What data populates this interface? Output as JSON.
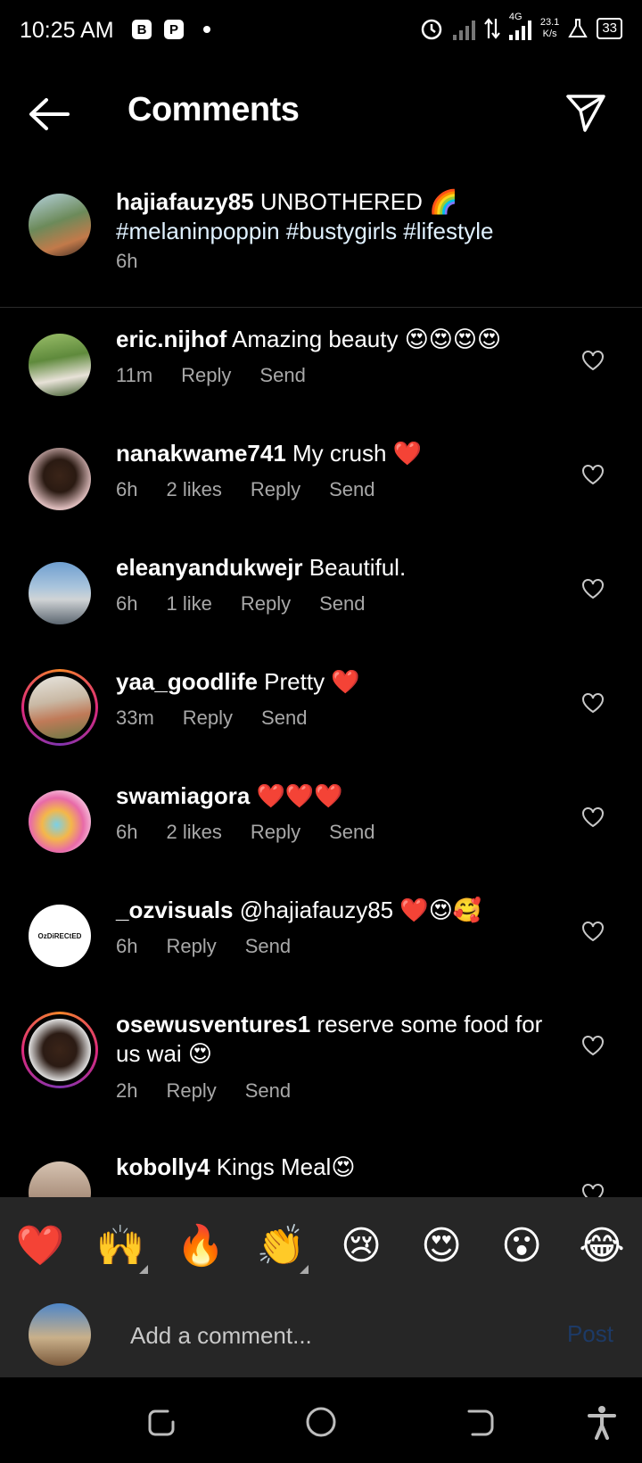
{
  "status_bar": {
    "time": "10:25 AM",
    "network": "4G",
    "speed_value": "23.1",
    "speed_unit": "K/s",
    "battery": "33"
  },
  "header": {
    "title": "Comments",
    "back_icon": "arrow-left-icon",
    "share_icon": "paper-plane-icon"
  },
  "caption": {
    "username": "hajiafauzy85",
    "text": " UNBOTHERED 🌈",
    "hashtags": "#melaninpoppin #bustygirls #lifestyle",
    "time": "6h"
  },
  "comments": [
    {
      "username": "eric.nijhof",
      "text": " Amazing beauty 😍😍😍😍",
      "time": "11m",
      "likes": "",
      "reply": "Reply",
      "send": "Send"
    },
    {
      "username": "nanakwame741",
      "text": " My crush ❤️",
      "time": "6h",
      "likes": "2 likes",
      "reply": "Reply",
      "send": "Send"
    },
    {
      "username": "eleanyandukwejr",
      "text": " Beautiful.",
      "time": "6h",
      "likes": "1 like",
      "reply": "Reply",
      "send": "Send"
    },
    {
      "username": "yaa_goodlife",
      "text": " Pretty ❤️",
      "time": "33m",
      "likes": "",
      "reply": "Reply",
      "send": "Send"
    },
    {
      "username": "swamiagora",
      "text": " ❤️❤️❤️",
      "time": "6h",
      "likes": "2 likes",
      "reply": "Reply",
      "send": "Send"
    },
    {
      "username": "_ozvisuals",
      "text": " @hajiafauzy85 ❤️😍🥰",
      "time": "6h",
      "likes": "",
      "reply": "Reply",
      "send": "Send",
      "avatar_text": "OzDiRECtED"
    },
    {
      "username": "osewusventures1",
      "text": " reserve some food for us wai 😍",
      "time": "2h",
      "likes": "",
      "reply": "Reply",
      "send": "Send"
    },
    {
      "username": "kobolly4",
      "text": " Kings Meal😍",
      "time": "",
      "likes": "",
      "reply": "",
      "send": ""
    }
  ],
  "emoji_bar": [
    "❤️",
    "🙌",
    "🔥",
    "👏",
    "😢",
    "😍",
    "😮",
    "😂"
  ],
  "composer": {
    "placeholder": "Add a comment...",
    "post_label": "Post"
  },
  "colors": {
    "background": "#000000",
    "panel": "#262626",
    "muted_text": "#a8a8a8",
    "post_disabled": "#1d3a66",
    "story_ring": "#dd2a7b"
  }
}
